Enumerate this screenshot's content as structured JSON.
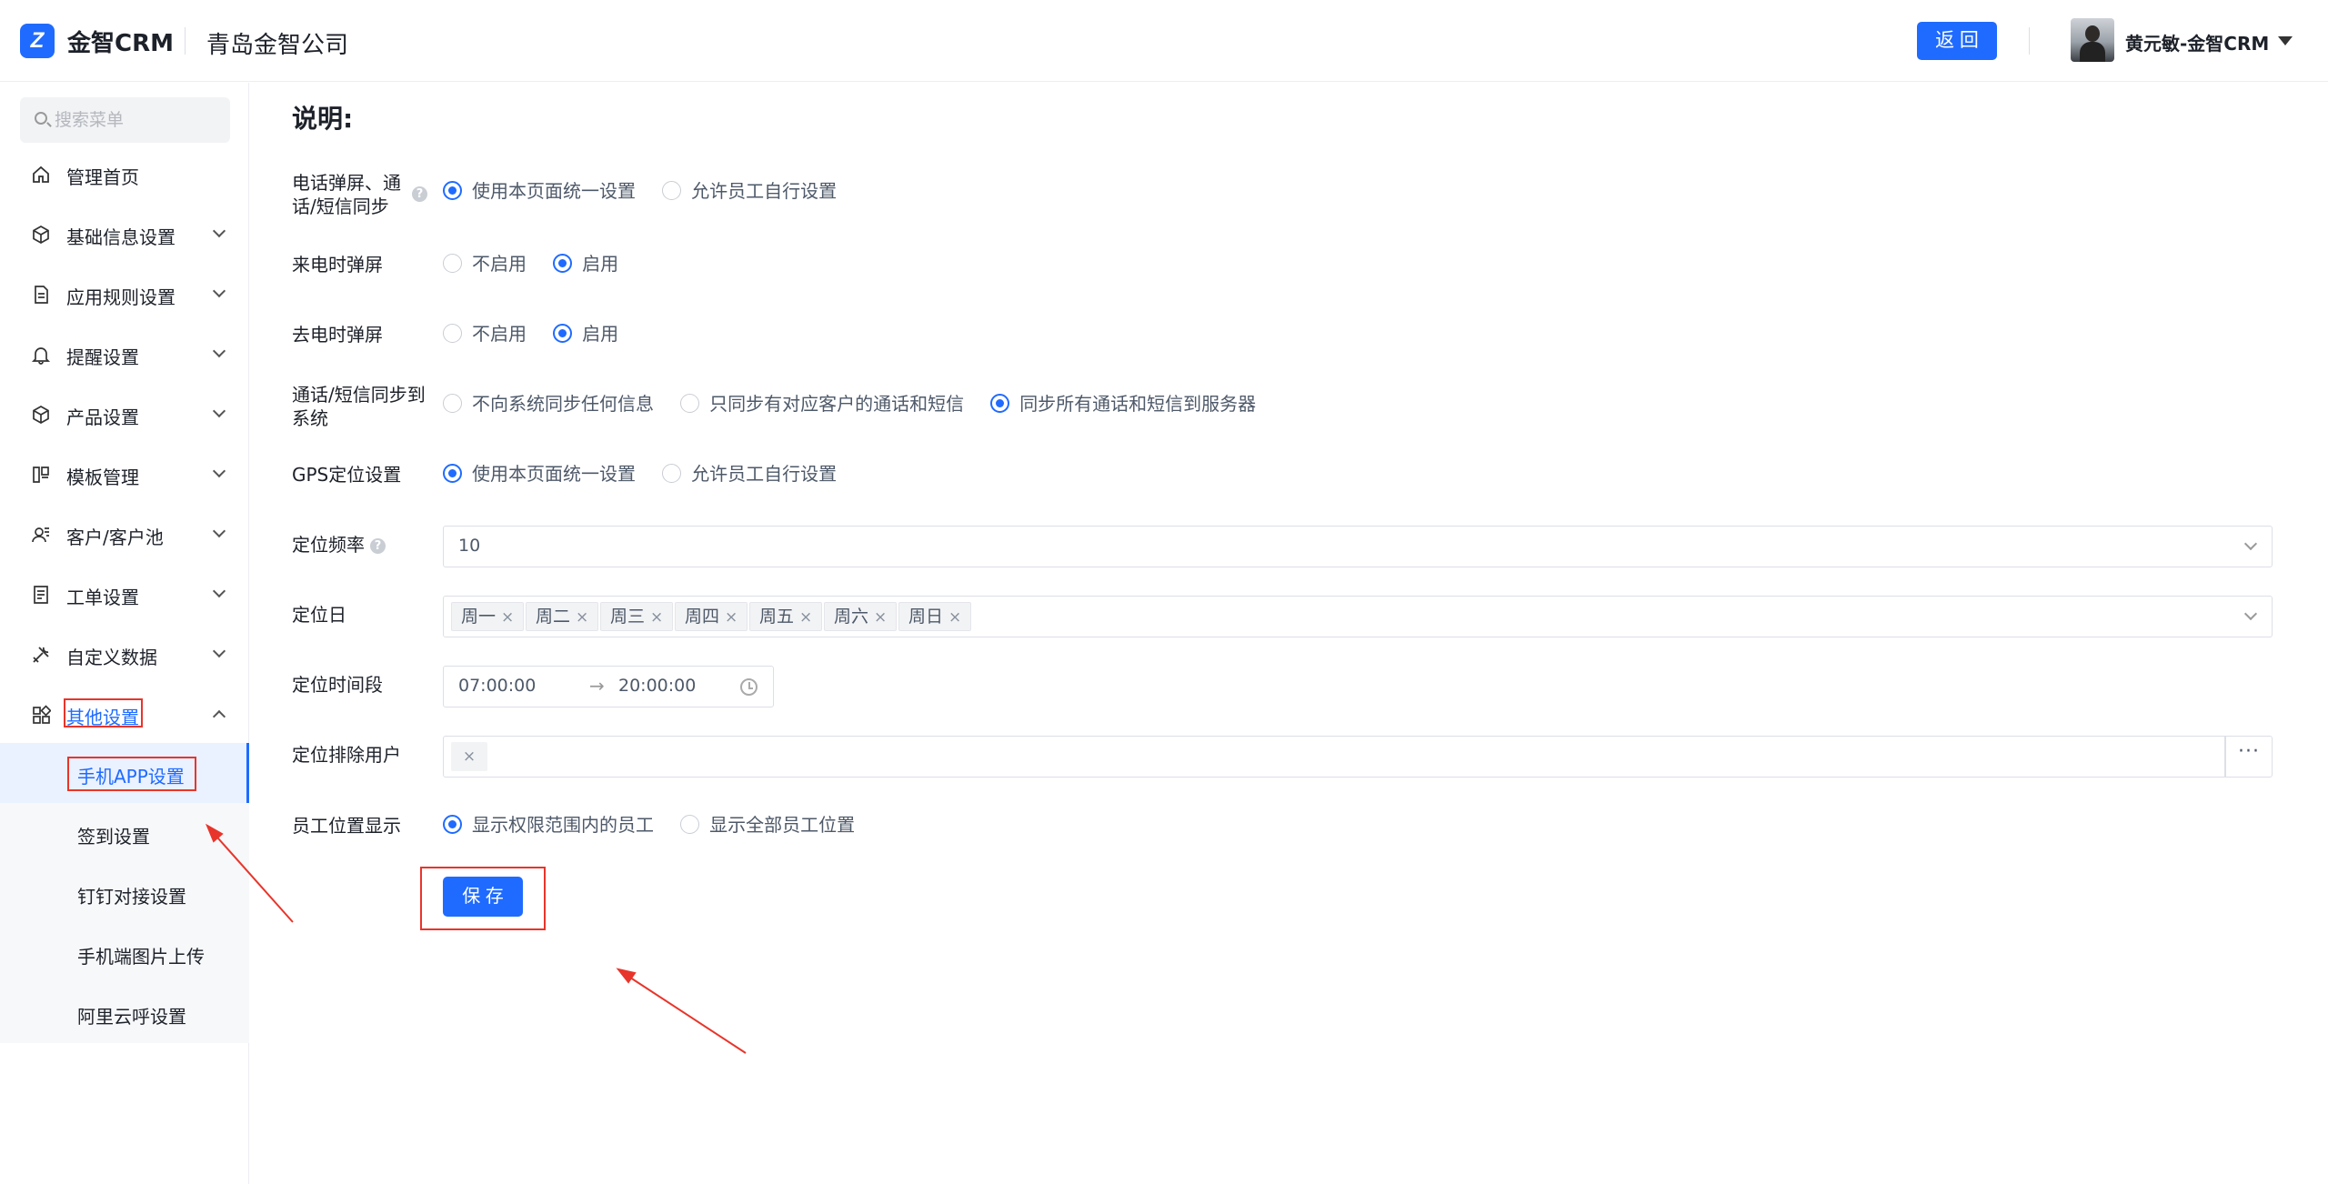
{
  "header": {
    "logo_text": "金智CRM",
    "company": "青岛金智公司",
    "back_label": "返 回",
    "username": "黄元敏-金智CRM"
  },
  "sidebar": {
    "search_placeholder": "搜索菜单",
    "items": [
      {
        "label": "管理首页",
        "icon": "home-icon"
      },
      {
        "label": "基础信息设置",
        "icon": "cube-icon"
      },
      {
        "label": "应用规则设置",
        "icon": "document-icon"
      },
      {
        "label": "提醒设置",
        "icon": "bell-icon"
      },
      {
        "label": "产品设置",
        "icon": "box-icon"
      },
      {
        "label": "模板管理",
        "icon": "layout-icon"
      },
      {
        "label": "客户/客户池",
        "icon": "contacts-icon"
      },
      {
        "label": "工单设置",
        "icon": "ticket-icon"
      },
      {
        "label": "自定义数据",
        "icon": "tools-icon"
      },
      {
        "label": "其他设置",
        "icon": "apps-icon"
      }
    ],
    "subitems": [
      {
        "label": "手机APP设置"
      },
      {
        "label": "签到设置"
      },
      {
        "label": "钉钉对接设置"
      },
      {
        "label": "手机端图片上传"
      },
      {
        "label": "阿里云呼设置"
      }
    ]
  },
  "main": {
    "title": "说明:",
    "rows": {
      "sync_label": "电话弹屏、通话/短信同步",
      "sync_opt1": "使用本页面统一设置",
      "sync_opt2": "允许员工自行设置",
      "incoming_label": "来电时弹屏",
      "incoming_opt1": "不启用",
      "incoming_opt2": "启用",
      "outgoing_label": "去电时弹屏",
      "outgoing_opt1": "不启用",
      "outgoing_opt2": "启用",
      "system_label": "通话/短信同步到系统",
      "system_opt1": "不向系统同步任何信息",
      "system_opt2": "只同步有对应客户的通话和短信",
      "system_opt3": "同步所有通话和短信到服务器",
      "gps_label": "GPS定位设置",
      "gps_opt1": "使用本页面统一设置",
      "gps_opt2": "允许员工自行设置",
      "freq_label": "定位频率",
      "freq_value": "10",
      "days_label": "定位日",
      "days": [
        "周一",
        "周二",
        "周三",
        "周四",
        "周五",
        "周六",
        "周日"
      ],
      "period_label": "定位时间段",
      "period_start": "07:00:00",
      "period_end": "20:00:00",
      "exclude_label": "定位排除用户",
      "exclude_more": "···",
      "staff_label": "员工位置显示",
      "staff_opt1": "显示权限范围内的员工",
      "staff_opt2": "显示全部员工位置"
    },
    "save_label": "保 存"
  },
  "colors": {
    "accent": "#1f6bff",
    "annotation": "#e8352b"
  }
}
